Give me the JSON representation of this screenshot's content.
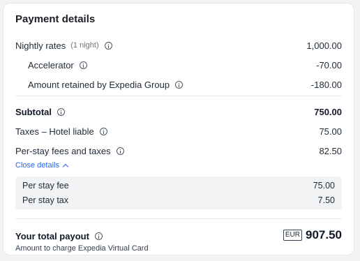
{
  "title": "Payment details",
  "rows": [
    {
      "label": "Nightly rates",
      "note": "(1 night)",
      "amount": "1,000.00"
    },
    {
      "label": "Accelerator",
      "amount": "-70.00"
    },
    {
      "label": "Amount retained by Expedia Group",
      "amount": "-180.00"
    },
    {
      "label": "Subtotal",
      "amount": "750.00"
    },
    {
      "label": "Taxes – Hotel liable",
      "amount": "75.00"
    },
    {
      "label": "Per-stay fees and taxes",
      "amount": "82.50"
    }
  ],
  "toggle": {
    "label": "Close details"
  },
  "details": [
    {
      "label": "Per stay fee",
      "amount": "75.00"
    },
    {
      "label": "Per stay tax",
      "amount": "7.50"
    }
  ],
  "payout": {
    "label": "Your total payout",
    "subtext": "Amount to charge Expedia Virtual Card",
    "currency": "EUR",
    "amount": "907.50"
  },
  "colors": {
    "link": "#2563eb",
    "detail_bg": "#f1f3f5"
  },
  "icons": {
    "info": "info-circle-icon",
    "toggle": "chevron-up-icon"
  }
}
